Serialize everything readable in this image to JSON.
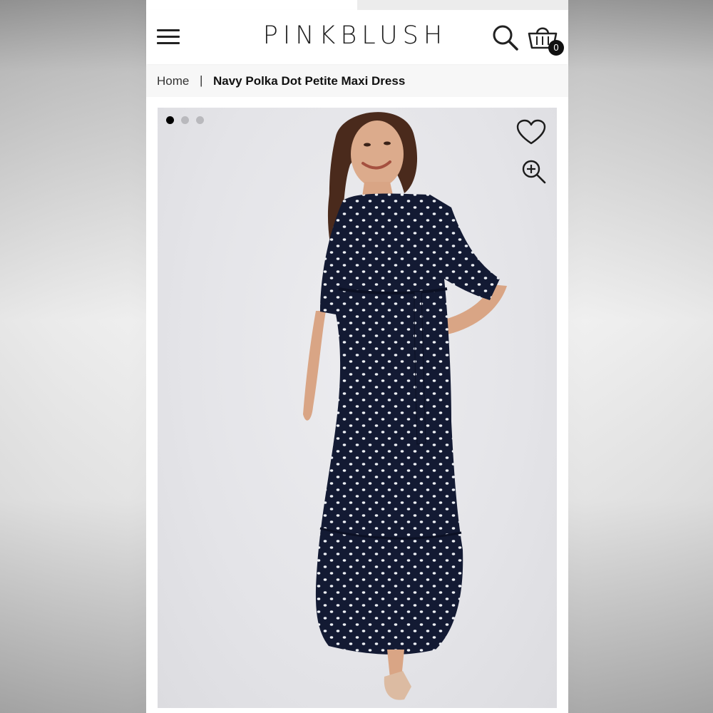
{
  "brand": {
    "logo_text": "PINKBLUSH"
  },
  "header": {
    "menu_icon": "hamburger-menu-icon",
    "search_icon": "search-icon",
    "cart_icon": "shopping-bag-icon",
    "cart_count": "0"
  },
  "breadcrumb": {
    "home": "Home",
    "separator": "|",
    "current": "Navy Polka Dot Petite Maxi Dress"
  },
  "gallery": {
    "image_alt": "Navy Polka Dot Petite Maxi Dress",
    "slides": [
      {
        "active": true
      },
      {
        "active": false
      },
      {
        "active": false
      }
    ],
    "wishlist_icon": "heart-icon",
    "zoom_icon": "zoom-in-icon"
  },
  "colors": {
    "dress_navy": "#131a33",
    "dot_white": "#eef1f6",
    "skin": "#d9a585",
    "hair": "#4a2a1c",
    "shoe": "#dcbba2",
    "active_dot": "#000000",
    "inactive_dot": "#b9b9bd"
  }
}
